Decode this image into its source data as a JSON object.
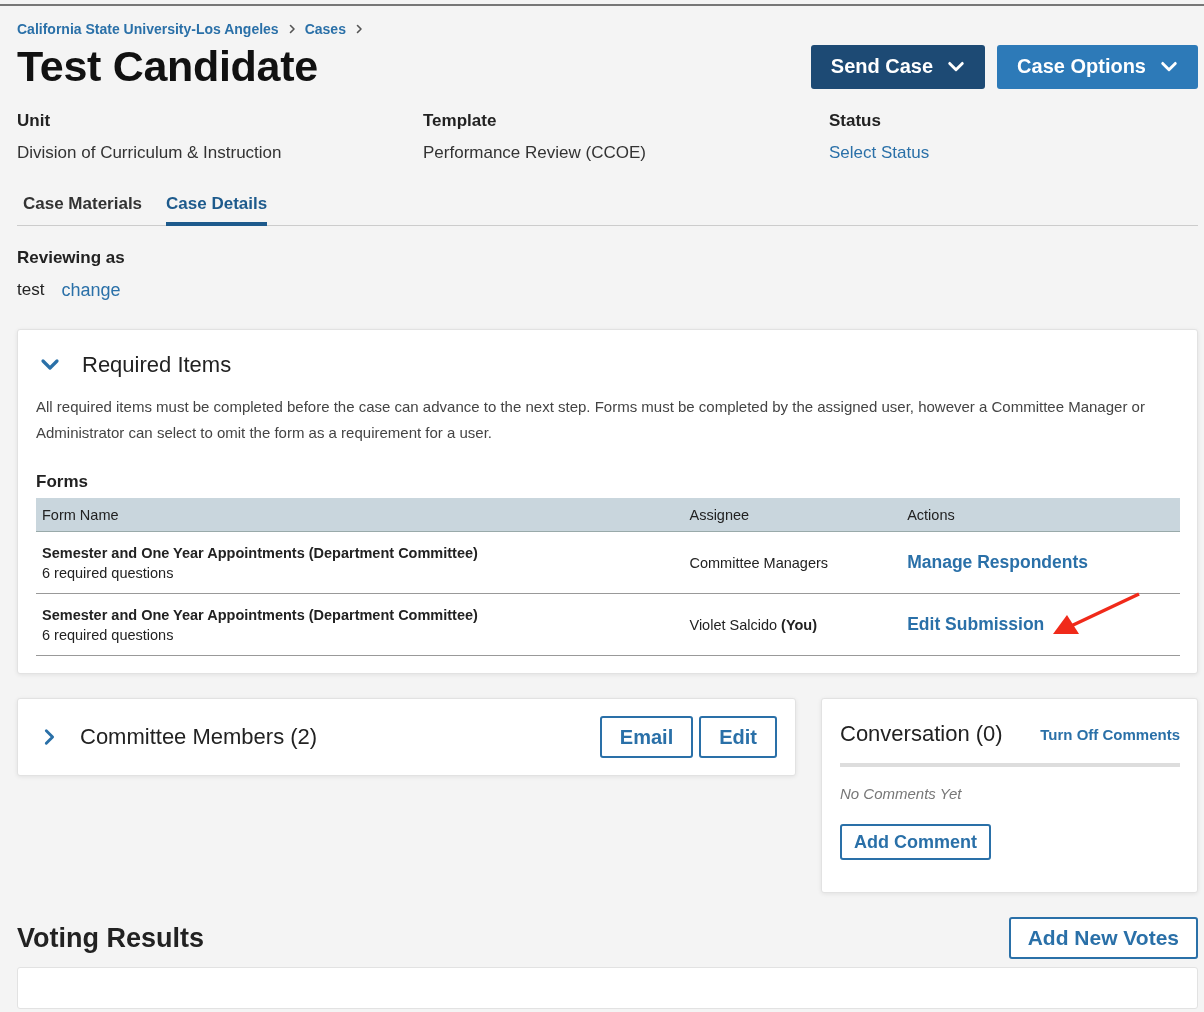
{
  "breadcrumb": [
    {
      "label": "California State University-Los Angeles"
    },
    {
      "label": "Cases"
    }
  ],
  "title": "Test Candidate",
  "header_buttons": [
    {
      "label": "Send Case",
      "kind": "dark"
    },
    {
      "label": "Case Options",
      "kind": "light"
    }
  ],
  "details": [
    {
      "label": "Unit",
      "value": "Division of Curriculum & Instruction",
      "kind": "text"
    },
    {
      "label": "Template",
      "value": "Performance Review (CCOE)",
      "kind": "text"
    },
    {
      "label": "Status",
      "value": "Select Status",
      "kind": "link"
    }
  ],
  "tabs": [
    {
      "label": "Case Materials",
      "selected": false
    },
    {
      "label": "Case Details",
      "selected": true
    }
  ],
  "reviewing": {
    "label": "Reviewing as",
    "value": "test",
    "action": "change"
  },
  "required_items": {
    "title": "Required Items",
    "expanded": true,
    "description": "All required items must be completed before the case can advance to the next step. Forms must be completed by the assigned user, however a Committee Manager or Administrator can select to omit the form as a requirement for a user.",
    "forms_heading": "Forms",
    "columns": [
      "Form Name",
      "Assignee",
      "Actions"
    ],
    "rows": [
      {
        "form_name": "Semester and One Year Appointments (Department Committee)",
        "questions": "6 required questions",
        "assignee": "Committee Managers",
        "action": "Manage Respondents",
        "annotated": false
      },
      {
        "form_name": "Semester and One Year Appointments (Department Committee)",
        "questions": "6 required questions",
        "assignee": "Violet Salcido **(You)**",
        "action": "Edit Submission",
        "annotated": true
      }
    ]
  },
  "committee": {
    "title": "Committee Members (2)",
    "expanded": false,
    "buttons": [
      "Email",
      "Edit"
    ]
  },
  "conversation": {
    "title": "Conversation (0)",
    "toggle": "Turn Off Comments",
    "empty": "No Comments Yet",
    "button": "Add Comment"
  },
  "voting": {
    "title": "Voting Results",
    "button": "Add New Votes"
  }
}
